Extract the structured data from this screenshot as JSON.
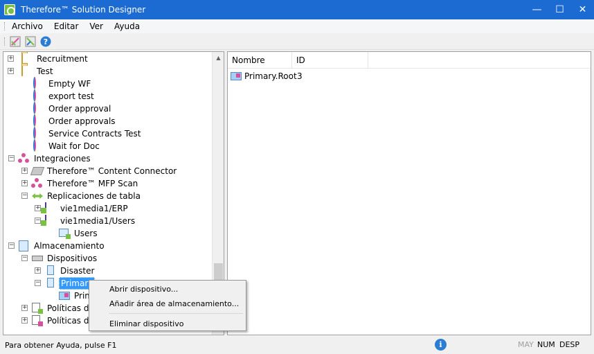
{
  "window": {
    "title": "Therefore™ Solution Designer",
    "minimize": "—",
    "maximize": "☐",
    "close": "✕"
  },
  "menu": [
    "Archivo",
    "Editar",
    "Ver",
    "Ayuda"
  ],
  "toolbar": {
    "buttons": [
      "designer-tool-icon",
      "designer-tool-2-icon",
      "help-icon"
    ],
    "help_glyph": "?"
  },
  "tree": {
    "items": [
      {
        "label": "Recruitment",
        "icon": "folder-icon"
      },
      {
        "label": "Test",
        "icon": "folder-icon"
      },
      {
        "label": "Empty WF",
        "icon": "workflow-icon"
      },
      {
        "label": "export test",
        "icon": "workflow-icon"
      },
      {
        "label": "Order approval",
        "icon": "workflow-icon"
      },
      {
        "label": "Order approvals",
        "icon": "workflow-icon"
      },
      {
        "label": "Service Contracts Test",
        "icon": "workflow-icon"
      },
      {
        "label": "Wait for Doc",
        "icon": "workflow-icon"
      },
      {
        "label": "Integraciones",
        "icon": "integrations-icon"
      },
      {
        "label": "Therefore™ Content Connector",
        "icon": "content-connector-icon"
      },
      {
        "label": "Therefore™ MFP Scan",
        "icon": "mfp-scan-icon"
      },
      {
        "label": "Replicaciones de tabla",
        "icon": "table-replication-icon"
      },
      {
        "label": "vie1media1/ERP",
        "icon": "database-replication-icon"
      },
      {
        "label": "vie1media1/Users",
        "icon": "database-replication-icon"
      },
      {
        "label": "Users",
        "icon": "table-icon"
      },
      {
        "label": "Almacenamiento",
        "icon": "storage-icon"
      },
      {
        "label": "Dispositivos",
        "icon": "devices-icon"
      },
      {
        "label": "Disaster",
        "icon": "storage-device-icon"
      },
      {
        "label": "Primary",
        "icon": "storage-device-icon"
      },
      {
        "label": "Prim",
        "icon": "storage-area-icon"
      },
      {
        "label": "Políticas de",
        "icon": "policy-icon"
      },
      {
        "label": "Políticas de",
        "icon": "policy-icon"
      }
    ],
    "expand": "+",
    "collapse": "−"
  },
  "list": {
    "columns": [
      "Nombre",
      "ID"
    ],
    "rows": [
      {
        "name": "Primary.Root",
        "id": "3"
      }
    ]
  },
  "context_menu": {
    "items": [
      "Abrir dispositivo...",
      "Añadir área de almacenamiento...",
      "Eliminar dispositivo"
    ]
  },
  "status": {
    "help_text": "Para obtener Ayuda, pulse F1",
    "info_glyph": "i",
    "indicators": [
      "MAY",
      "NUM",
      "DESP"
    ]
  },
  "colors": {
    "titlebar": "#1c6bd3",
    "selection": "#3399ff"
  }
}
